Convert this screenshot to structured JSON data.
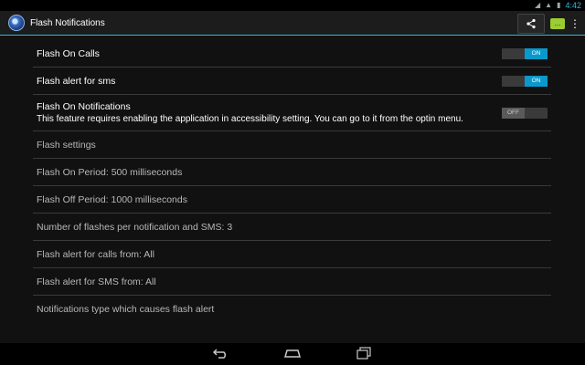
{
  "status_bar": {
    "time": "4:42"
  },
  "action_bar": {
    "title": "Flash Notifications"
  },
  "settings": {
    "flash_on_calls": {
      "label": "Flash On Calls",
      "toggle_text": "ON"
    },
    "flash_alert_sms": {
      "label": "Flash alert for sms",
      "toggle_text": "ON"
    },
    "flash_on_notifications": {
      "label": "Flash On Notifications",
      "summary": "This feature requires enabling the application in accessibility setting. You can go to it from the optin menu.",
      "toggle_text": "OFF"
    },
    "flash_settings": {
      "label": "Flash settings"
    },
    "flash_on_period": {
      "label": "Flash On Period: 500 milliseconds"
    },
    "flash_off_period": {
      "label": "Flash Off Period: 1000 milliseconds"
    },
    "num_flashes": {
      "label": "Number of flashes per notification and SMS: 3"
    },
    "calls_from": {
      "label": "Flash alert for calls from: All"
    },
    "sms_from": {
      "label": "Flash alert for SMS from: All"
    },
    "notifications_type": {
      "label": "Notifications type which causes flash alert"
    }
  },
  "colors": {
    "accent": "#33b5e5",
    "toggle_on": "#0a99cc",
    "background": "#111111"
  }
}
